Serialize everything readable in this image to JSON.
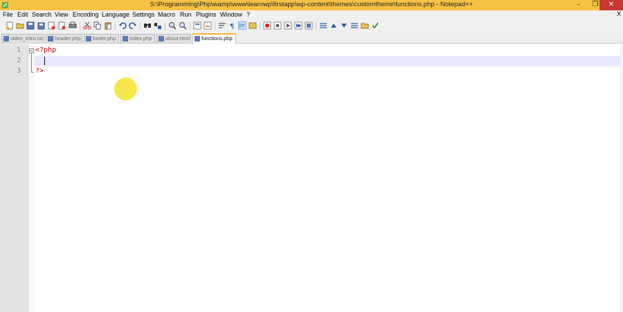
{
  "window": {
    "title": "S:\\Programming\\Php\\wamp\\www\\learnwp\\firstapp\\wp-content\\themes\\customtheme\\functions.php - Notepad++",
    "minimize": "–",
    "restore": "❐",
    "close": "✕",
    "accent": "#f6c244"
  },
  "menu": {
    "items": [
      "File",
      "Edit",
      "Search",
      "View",
      "Encoding",
      "Language",
      "Settings",
      "Macro",
      "Run",
      "Plugins",
      "Window",
      "?"
    ],
    "close_doc": "X"
  },
  "toolbar": {
    "icons": [
      "new-file-icon",
      "open-file-icon",
      "save-icon",
      "save-all-icon",
      "close-icon",
      "close-all-icon",
      "print-icon",
      "cut-icon",
      "copy-icon",
      "paste-icon",
      "undo-icon",
      "redo-icon",
      "find-icon",
      "replace-icon",
      "zoom-in-icon",
      "zoom-out-icon",
      "sync-v-icon",
      "sync-h-icon",
      "word-wrap-icon",
      "show-all-chars-icon",
      "indent-guide-icon",
      "doc-map-icon",
      "record-macro-icon",
      "stop-record-icon",
      "play-macro-icon",
      "play-multiple-icon",
      "save-macro-icon",
      "fold-all-icon",
      "up-arrow-icon",
      "down-arrow-icon",
      "unfold-icon",
      "folder-icon",
      "spell-check-icon"
    ]
  },
  "tabs": [
    {
      "label": "video_intro.txt",
      "active": false
    },
    {
      "label": "header.php",
      "active": false
    },
    {
      "label": "footer.php",
      "active": false
    },
    {
      "label": "index.php",
      "active": false
    },
    {
      "label": "about.html",
      "active": false
    },
    {
      "label": "functions.php",
      "active": true
    }
  ],
  "editor": {
    "line_numbers": [
      "1",
      "2",
      "3"
    ],
    "lines": [
      "<?php",
      "",
      "?>"
    ],
    "current_line": 2
  }
}
